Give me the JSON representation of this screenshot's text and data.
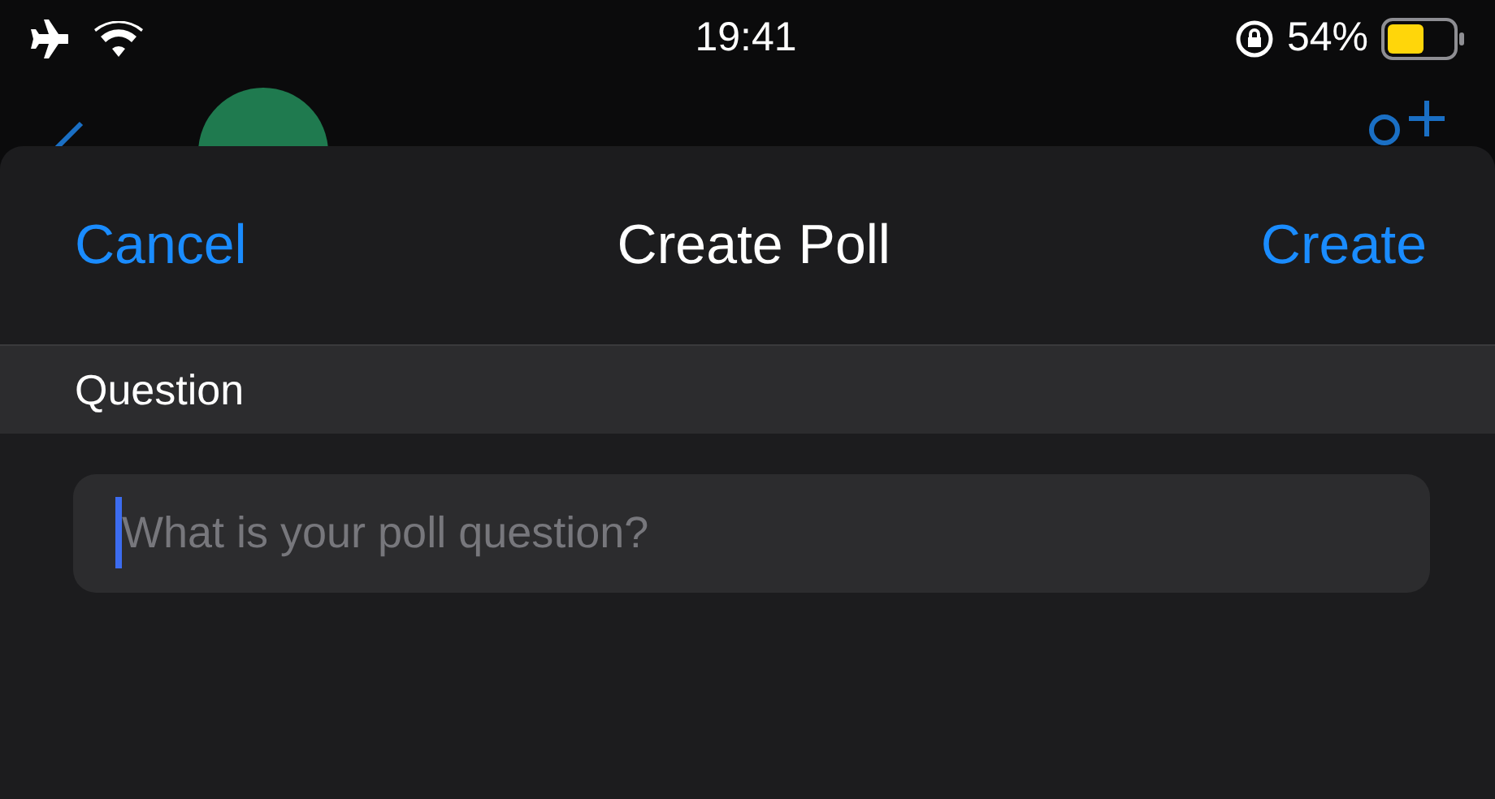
{
  "status_bar": {
    "time": "19:41",
    "battery_text": "54%"
  },
  "sheet": {
    "cancel": "Cancel",
    "title": "Create Poll",
    "create": "Create"
  },
  "section": {
    "title": "Question"
  },
  "question_field": {
    "placeholder": "What is your poll question?",
    "focused": true
  }
}
